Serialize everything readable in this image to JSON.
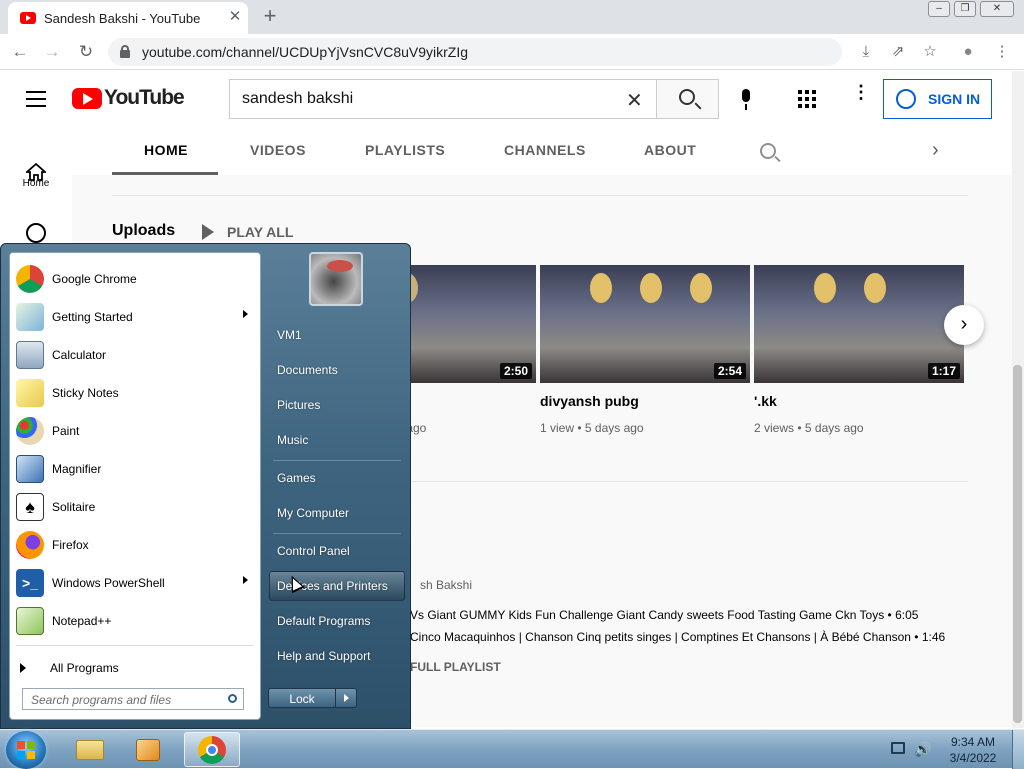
{
  "browser": {
    "tab_title": "Sandesh Bakshi - YouTube",
    "tab_close": "✕",
    "new_tab": "+",
    "window_controls": {
      "minimize": "‒",
      "restore": "❐",
      "close": "✕"
    },
    "nav": {
      "back": "←",
      "forward": "→",
      "reload": "↻"
    },
    "url": "youtube.com/channel/UCDUpYjVsnCVC8uV9yikrZIg",
    "toolbar_icons": {
      "install": "⤓",
      "share": "⇗",
      "bookmark": "☆",
      "profile": "●",
      "menu": "⋮"
    }
  },
  "youtube": {
    "logo_text": "YouTube",
    "search": {
      "value": "sandesh bakshi",
      "clear": "✕"
    },
    "more": "⋮",
    "sign_in": "SIGN IN",
    "guide": {
      "home": "Home"
    },
    "channel_tabs": [
      "HOME",
      "VIDEOS",
      "PLAYLISTS",
      "CHANNELS",
      "ABOUT"
    ],
    "tab_next": "›",
    "uploads": {
      "title": "Uploads",
      "play_all": "PLAY ALL",
      "videos": [
        {
          "title": "",
          "meta": "s ago",
          "duration": "2:50"
        },
        {
          "title": "divyansh pubg",
          "meta": "1 view • 5 days ago",
          "duration": "2:54"
        },
        {
          "title": "'.kk",
          "meta": "2 views • 5 days ago",
          "duration": "1:17"
        }
      ],
      "carousel_next": "›"
    },
    "playlist": {
      "owner": "sh Bakshi",
      "items": [
        "Vs Giant GUMMY Kids Fun Challenge Giant Candy sweets Food Tasting Game Ckn Toys • 6:05",
        "Cinco Macaquinhos | Chanson Cinq petits singes | Comptines Et Chansons | À Bébé Chanson • 1:46"
      ],
      "view_full": "FULL PLAYLIST"
    }
  },
  "start_menu": {
    "programs": [
      {
        "label": "Google Chrome",
        "icon": "chrome-icon",
        "submenu": false
      },
      {
        "label": "Getting Started",
        "icon": "getting-started-icon",
        "submenu": true
      },
      {
        "label": "Calculator",
        "icon": "calculator-icon",
        "submenu": false
      },
      {
        "label": "Sticky Notes",
        "icon": "sticky-notes-icon",
        "submenu": false
      },
      {
        "label": "Paint",
        "icon": "paint-icon",
        "submenu": false
      },
      {
        "label": "Magnifier",
        "icon": "magnifier-icon",
        "submenu": false
      },
      {
        "label": "Solitaire",
        "icon": "solitaire-icon",
        "submenu": false
      },
      {
        "label": "Firefox",
        "icon": "firefox-icon",
        "submenu": false
      },
      {
        "label": "Windows PowerShell",
        "icon": "powershell-icon",
        "submenu": true
      },
      {
        "label": "Notepad++",
        "icon": "notepadpp-icon",
        "submenu": false
      }
    ],
    "all_programs": "All Programs",
    "search_placeholder": "Search programs and files",
    "right_items": [
      "VM1",
      "Documents",
      "Pictures",
      "Music",
      "Games",
      "My Computer",
      "Control Panel",
      "Devices and Printers",
      "Default Programs",
      "Help and Support"
    ],
    "highlighted": "Devices and Printers",
    "lock": "Lock"
  },
  "taskbar": {
    "clock_time": "9:34 AM",
    "clock_date": "3/4/2022",
    "volume_icon": "🔊"
  }
}
